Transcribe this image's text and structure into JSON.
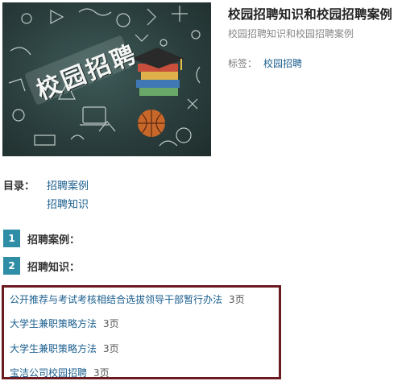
{
  "cover": {
    "banner_text": "校园招聘"
  },
  "header": {
    "title": "校园招聘知识和校园招聘案例",
    "subtitle": "校园招聘知识和校园招聘案例",
    "tag_label": "标签：",
    "tag_value": "校园招聘"
  },
  "toc": {
    "label": "目录：",
    "items": [
      {
        "label": "招聘案例"
      },
      {
        "label": "招聘知识"
      }
    ]
  },
  "sections": [
    {
      "num": "1",
      "title": "招聘案例："
    },
    {
      "num": "2",
      "title": "招聘知识："
    }
  ],
  "docs": [
    {
      "title": "公开推荐与考试考核相结合选拔领导干部暂行办法",
      "pages": "3页"
    },
    {
      "title": "大学生兼职策略方法",
      "pages": "3页"
    },
    {
      "title": "大学生兼职策略方法",
      "pages": "3页"
    },
    {
      "title": "宝洁公司校园招聘",
      "pages": "3页"
    }
  ],
  "colors": {
    "link": "#1a5e8e",
    "section_badge": "#2f8ea6",
    "box_border": "#6b1a22"
  }
}
